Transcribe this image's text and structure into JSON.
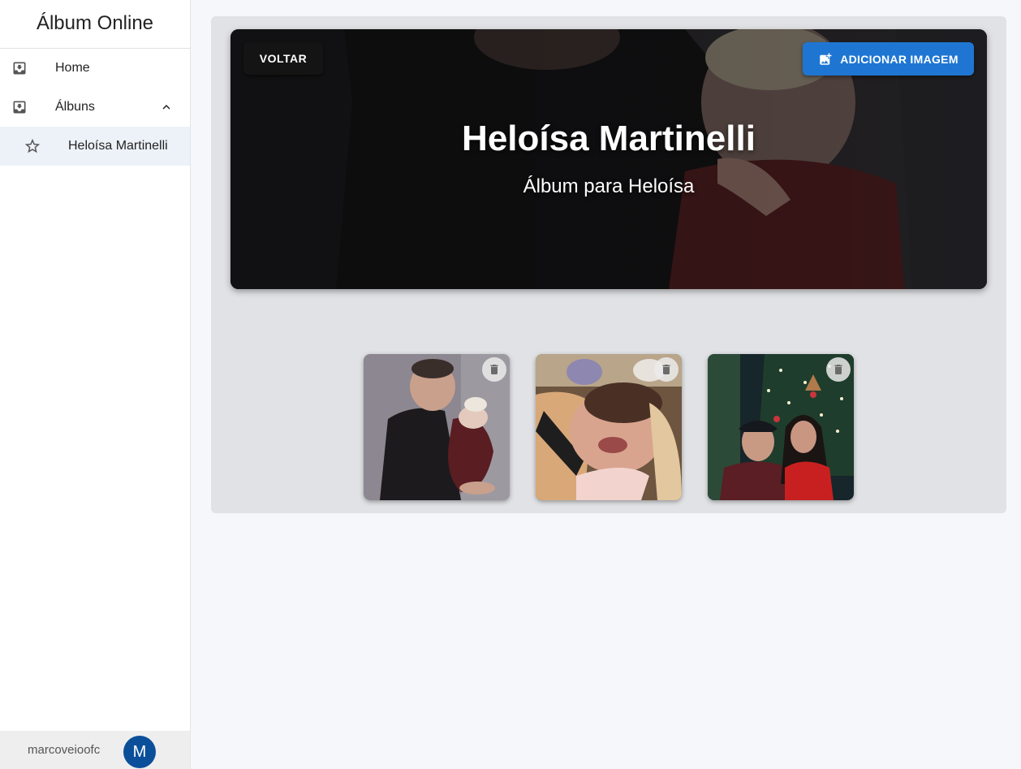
{
  "app": {
    "title": "Álbum Online"
  },
  "sidebar": {
    "items": [
      {
        "label": "Home",
        "icon": "inbox-download-icon"
      },
      {
        "label": "Álbuns",
        "icon": "inbox-download-icon",
        "expanded": true
      }
    ],
    "sub_items": [
      {
        "label": "Heloísa Martinelli",
        "icon": "star-outline-icon",
        "selected": true
      }
    ]
  },
  "user": {
    "username": "marcoveioofc",
    "avatar_initial": "M",
    "avatar_color": "#0b4f9a"
  },
  "album": {
    "title": "Heloísa Martinelli",
    "subtitle": "Álbum para Heloísa",
    "back_label": "VOLTAR",
    "add_label": "ADICIONAR IMAGEM",
    "add_icon": "add-photo-icon"
  },
  "photos": [
    {
      "alt": "photo-father-with-newborn",
      "delete_icon": "trash-icon"
    },
    {
      "alt": "photo-smiling-newborn",
      "delete_icon": "trash-icon"
    },
    {
      "alt": "photo-couple-christmas-tree",
      "delete_icon": "trash-icon"
    }
  ],
  "colors": {
    "primary": "#1e76d2",
    "sidebar_selected_bg": "#edf2f9",
    "panel_bg": "#e1e2e5",
    "page_bg": "#f5f7fa"
  }
}
